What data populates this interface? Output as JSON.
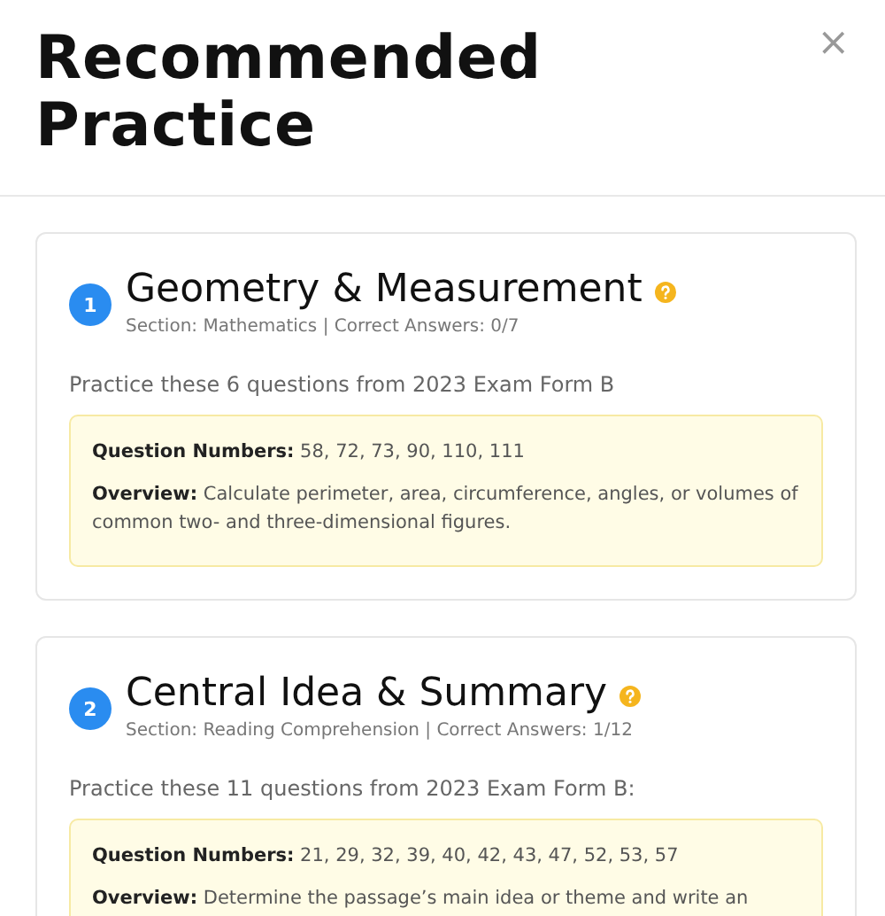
{
  "title": "Recommended Practice",
  "close": "×",
  "topics": [
    {
      "number": "1",
      "name": "Geometry & Measurement",
      "meta": "Section: Mathematics | Correct Answers: 0/7",
      "intro": "Practice these 6 questions from 2023 Exam Form B",
      "details": [
        "**Question Numbers:** 58, 72, 73, 90, 110, 111",
        "**Overview:** Calculate perimeter, area, circumference, angles, or volumes of common two- and three-dimensional figures."
      ]
    },
    {
      "number": "2",
      "name": "Central Idea & Summary",
      "meta": "Section: Reading Comprehension | Correct Answers: 1/12",
      "intro": "Practice these 11 questions from 2023 Exam Form B:",
      "details": [
        "**Question Numbers:** 21, 29, 32, 39, 40, 42, 43, 47, 52, 53, 57",
        "**Overview:** Determine the passage’s main idea or theme and write an"
      ]
    }
  ]
}
